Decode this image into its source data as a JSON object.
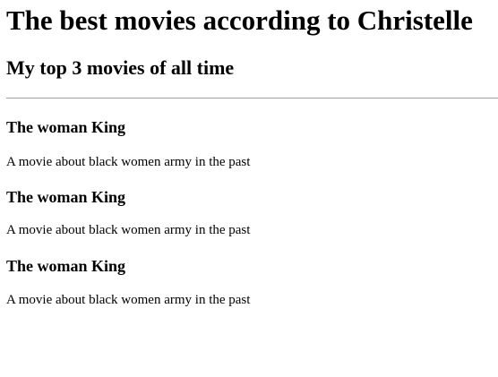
{
  "page": {
    "title": "The best movies according to Christelle",
    "subtitle": "My top 3 movies of all time"
  },
  "movies": [
    {
      "title": "The woman King",
      "description": "A movie about black women army in the past"
    },
    {
      "title": "The woman King",
      "description": "A movie about black women army in the past"
    },
    {
      "title": "The woman King",
      "description": "A movie about black women army in the past"
    }
  ]
}
